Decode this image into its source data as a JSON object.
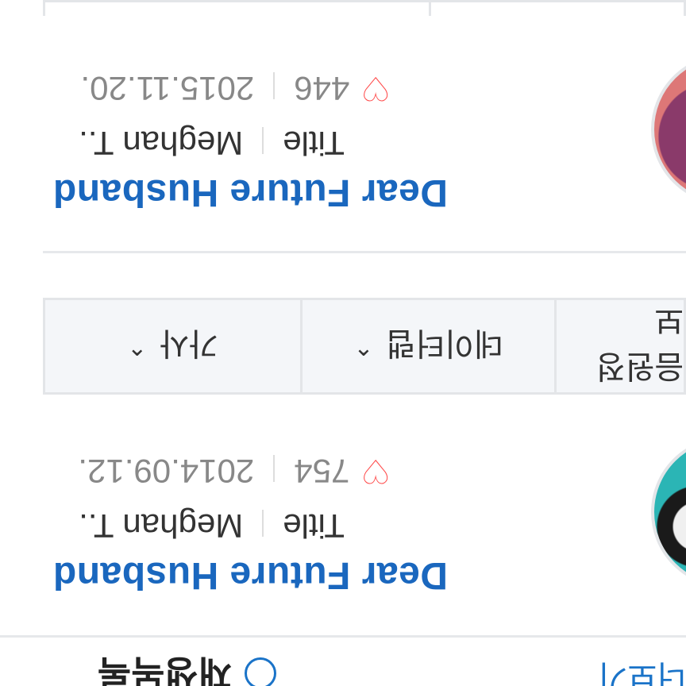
{
  "section": {
    "title": "재생목록",
    "more_link": "더보기"
  },
  "items": [
    {
      "title": "Dear Future Husband",
      "type": "Title",
      "artist": "Meghan T..",
      "date": "2014.09.12.",
      "likes": "754"
    },
    {
      "title": "Dear Future Husband",
      "type": "Title",
      "artist": "Meghan T..",
      "date": "2015.11.20.",
      "likes": "446"
    }
  ],
  "sort_tabs": [
    {
      "label": "가사",
      "icon": "chevron-up-icon"
    },
    {
      "label": "데이터랩",
      "icon": "chevron-up-icon"
    },
    {
      "label": "음원정보",
      "icon": "chevron-up-icon"
    }
  ],
  "colors": {
    "title_blue": "#1a67be",
    "heart_red": "#ff4a4a",
    "link_blue": "#1a73c8",
    "border": "#e3e5e8",
    "tab_bg": "#f4f6f9"
  }
}
